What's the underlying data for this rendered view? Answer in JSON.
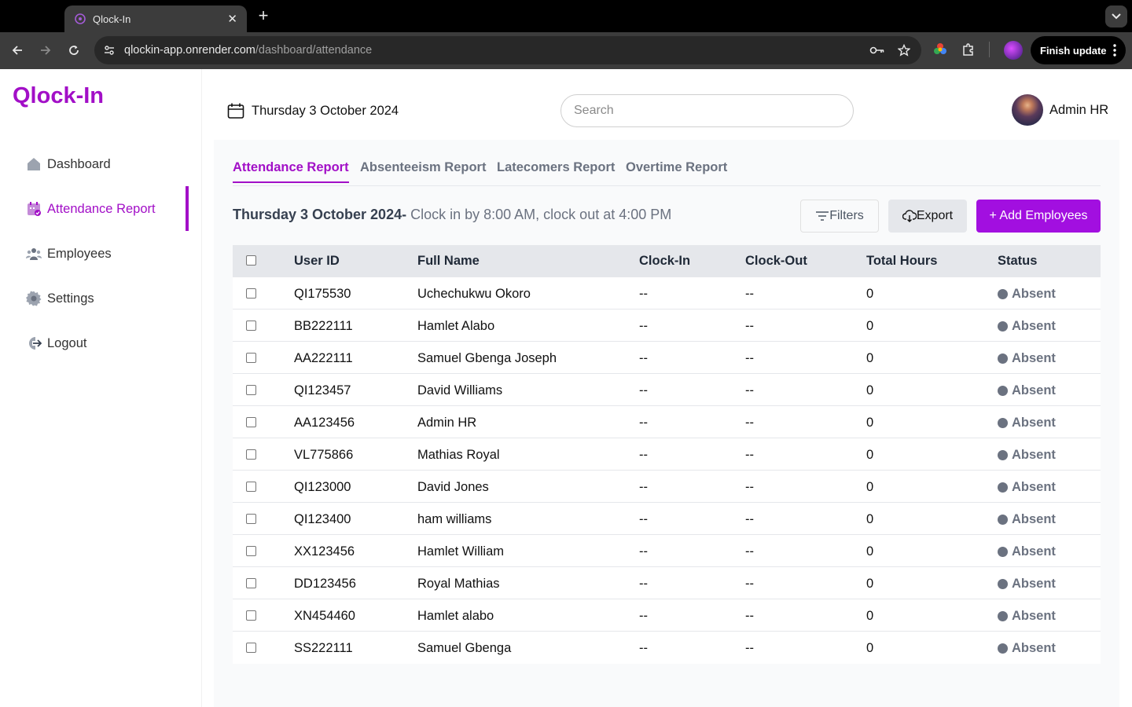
{
  "browser": {
    "tab_title": "Qlock-In",
    "url_host": "qlockin-app.onrender.com",
    "url_path": "/dashboard/attendance",
    "finish_update": "Finish update"
  },
  "app": {
    "logo": "Qlock-In",
    "accent_color": "#a20fc7"
  },
  "sidebar": {
    "items": [
      {
        "label": "Dashboard",
        "icon": "home-icon"
      },
      {
        "label": "Attendance Report",
        "icon": "calendar-check-icon"
      },
      {
        "label": "Employees",
        "icon": "people-icon"
      },
      {
        "label": "Settings",
        "icon": "gear-icon"
      },
      {
        "label": "Logout",
        "icon": "logout-icon"
      }
    ]
  },
  "header": {
    "date": "Thursday 3 October 2024",
    "search_placeholder": "Search",
    "user_name": "Admin HR"
  },
  "report_tabs": [
    {
      "label": "Attendance Report",
      "active": true
    },
    {
      "label": "Absenteeism Report",
      "active": false
    },
    {
      "label": "Latecomers Report",
      "active": false
    },
    {
      "label": "Overtime Report",
      "active": false
    }
  ],
  "subtitle": {
    "date": "Thursday 3 October 2024-",
    "rule": " Clock in by 8:00 AM, clock out at 4:00 PM"
  },
  "actions": {
    "filters": "Filters",
    "export": "Export",
    "add": "+ Add Employees"
  },
  "table": {
    "columns": [
      "User ID",
      "Full Name",
      "Clock-In",
      "Clock-Out",
      "Total Hours",
      "Status"
    ],
    "rows": [
      {
        "id": "QI175530",
        "name": "Uchechukwu Okoro",
        "in": "--",
        "out": "--",
        "hours": "0",
        "status": "Absent"
      },
      {
        "id": "BB222111",
        "name": "Hamlet Alabo",
        "in": "--",
        "out": "--",
        "hours": "0",
        "status": "Absent"
      },
      {
        "id": "AA222111",
        "name": "Samuel Gbenga Joseph",
        "in": "--",
        "out": "--",
        "hours": "0",
        "status": "Absent"
      },
      {
        "id": "QI123457",
        "name": "David Williams",
        "in": "--",
        "out": "--",
        "hours": "0",
        "status": "Absent"
      },
      {
        "id": "AA123456",
        "name": "Admin HR",
        "in": "--",
        "out": "--",
        "hours": "0",
        "status": "Absent"
      },
      {
        "id": "VL775866",
        "name": "Mathias Royal",
        "in": "--",
        "out": "--",
        "hours": "0",
        "status": "Absent"
      },
      {
        "id": "QI123000",
        "name": "David Jones",
        "in": "--",
        "out": "--",
        "hours": "0",
        "status": "Absent"
      },
      {
        "id": "QI123400",
        "name": "ham williams",
        "in": "--",
        "out": "--",
        "hours": "0",
        "status": "Absent"
      },
      {
        "id": "XX123456",
        "name": "Hamlet William",
        "in": "--",
        "out": "--",
        "hours": "0",
        "status": "Absent"
      },
      {
        "id": "DD123456",
        "name": "Royal Mathias",
        "in": "--",
        "out": "--",
        "hours": "0",
        "status": "Absent"
      },
      {
        "id": "XN454460",
        "name": "Hamlet alabo",
        "in": "--",
        "out": "--",
        "hours": "0",
        "status": "Absent"
      },
      {
        "id": "SS222111",
        "name": "Samuel Gbenga",
        "in": "--",
        "out": "--",
        "hours": "0",
        "status": "Absent"
      }
    ]
  }
}
